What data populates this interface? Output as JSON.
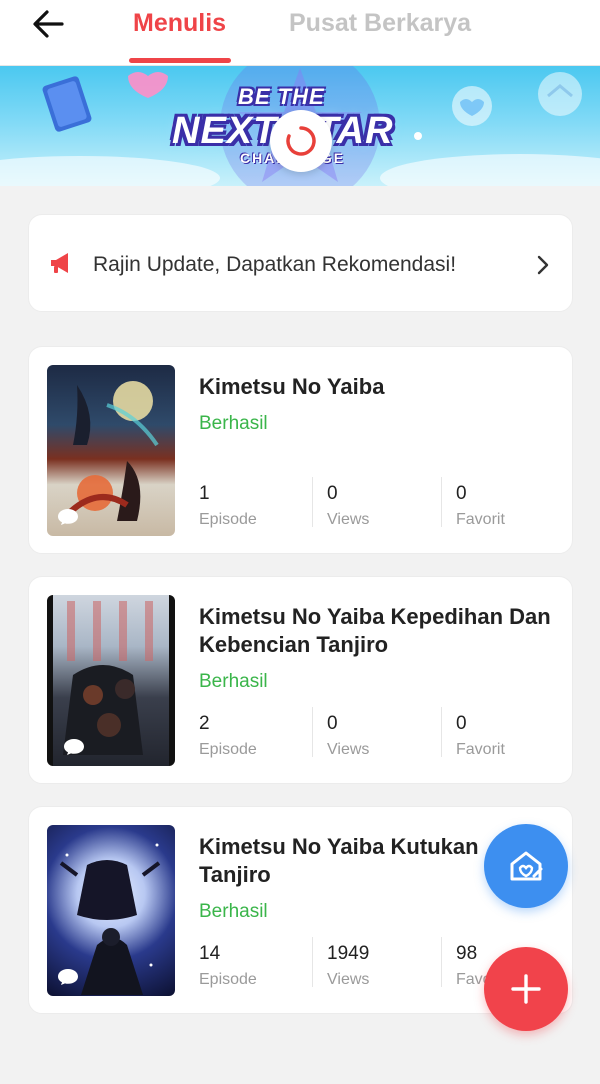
{
  "colors": {
    "accent": "#ef4448",
    "success": "#3ab54a",
    "fab_blue": "#3d8ff0",
    "fab_red": "#f1434b",
    "tab_inactive": "#c4c4c4"
  },
  "header": {
    "back_icon": "arrow-left-icon",
    "tabs": [
      {
        "label": "Menulis",
        "active": true
      },
      {
        "label": "Pusat Berkarya",
        "active": false
      }
    ]
  },
  "banner": {
    "line1": "BE THE",
    "line2": "NEXT STAR",
    "line3": "CHALLENGE",
    "loading_icon": "loading-spinner-icon"
  },
  "notice": {
    "icon": "megaphone-icon",
    "text": "Rajin Update, Dapatkan Rekomendasi!",
    "chevron_icon": "chevron-right-icon"
  },
  "works": [
    {
      "title": "Kimetsu No Yaiba",
      "status": "Berhasil",
      "stats": [
        {
          "value": "1",
          "label": "Episode"
        },
        {
          "value": "0",
          "label": "Views"
        },
        {
          "value": "0",
          "label": "Favorit"
        }
      ]
    },
    {
      "title": "Kimetsu No Yaiba Kepedihan Dan Kebencian Tanjiro",
      "status": "Berhasil",
      "stats": [
        {
          "value": "2",
          "label": "Episode"
        },
        {
          "value": "0",
          "label": "Views"
        },
        {
          "value": "0",
          "label": "Favorit"
        }
      ]
    },
    {
      "title": "Kimetsu No Yaiba Kutukan Tanjiro",
      "status": "Berhasil",
      "stats": [
        {
          "value": "14",
          "label": "Episode"
        },
        {
          "value": "1949",
          "label": "Views"
        },
        {
          "value": "98",
          "label": "Favorit"
        }
      ]
    }
  ],
  "fabs": {
    "blue_icon": "home-edit-icon",
    "red_icon": "plus-icon"
  }
}
